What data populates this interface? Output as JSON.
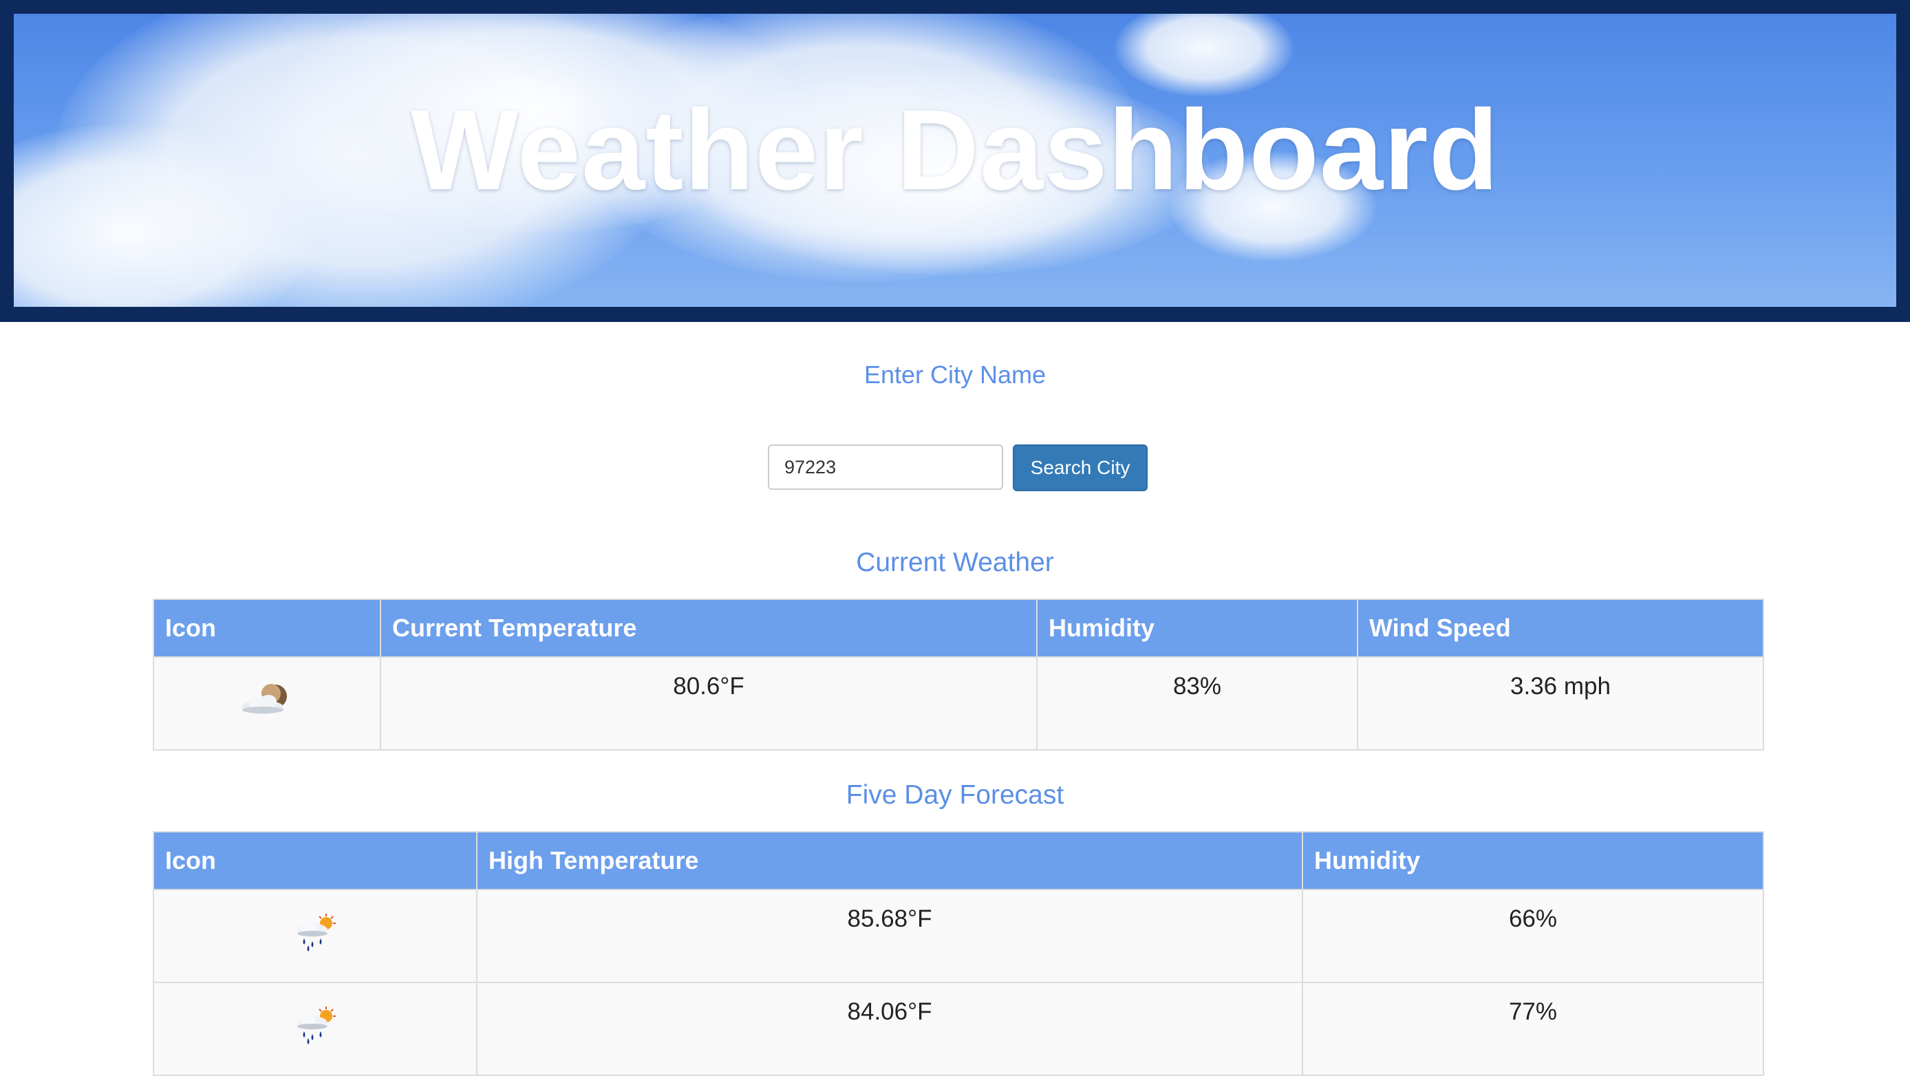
{
  "header": {
    "title": "Weather Dashboard"
  },
  "search": {
    "heading": "Enter City Name",
    "input_value": "97223",
    "button_label": "Search City"
  },
  "current_weather": {
    "heading": "Current Weather",
    "columns": [
      "Icon",
      "Current Temperature",
      "Humidity",
      "Wind Speed"
    ],
    "row": {
      "icon": "cloud-moon-icon",
      "temperature": "80.6°F",
      "humidity": "83%",
      "wind_speed": "3.36 mph"
    }
  },
  "forecast": {
    "heading": "Five Day Forecast",
    "columns": [
      "Icon",
      "High Temperature",
      "Humidity"
    ],
    "rows": [
      {
        "icon": "rain-sun-icon",
        "high": "85.68°F",
        "humidity": "66%"
      },
      {
        "icon": "rain-sun-icon",
        "high": "84.06°F",
        "humidity": "77%"
      }
    ]
  },
  "colors": {
    "banner_border": "#0e2a5c",
    "accent_text": "#5b8fe6",
    "table_header": "#6c9fec",
    "button": "#337ab7"
  }
}
